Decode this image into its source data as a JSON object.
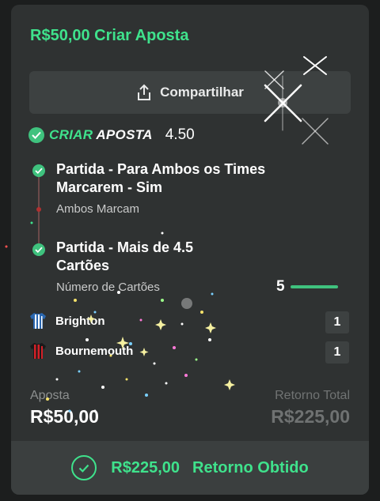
{
  "header": {
    "title": "R$50,00 Criar Aposta"
  },
  "share": {
    "label": "Compartilhar",
    "icon": "share-icon"
  },
  "bet_builder": {
    "label_part1": "CRIAR",
    "label_part2": "APOSTA",
    "odds": "4.50"
  },
  "selections": [
    {
      "title": "Partida - Para Ambos os Times Marcarem - Sim",
      "subtitle": "Ambos Marcam"
    },
    {
      "title": "Partida - Mais de 4.5 Cartões",
      "subtitle": "Número de Cartões",
      "value": "5"
    }
  ],
  "teams": [
    {
      "name": "Brighton",
      "score": "1",
      "kit_icon": "brighton-shirt-icon"
    },
    {
      "name": "Bournemouth",
      "score": "1",
      "kit_icon": "bournemouth-shirt-icon"
    }
  ],
  "summary": {
    "stake_label": "Aposta",
    "stake_value": "R$50,00",
    "return_label": "Retorno Total",
    "return_value": "R$225,00"
  },
  "footer": {
    "amount": "R$225,00",
    "label": "Retorno Obtido"
  },
  "colors": {
    "accent": "#3fe28c",
    "card": "#2f3232",
    "background": "#1c1e1e"
  }
}
